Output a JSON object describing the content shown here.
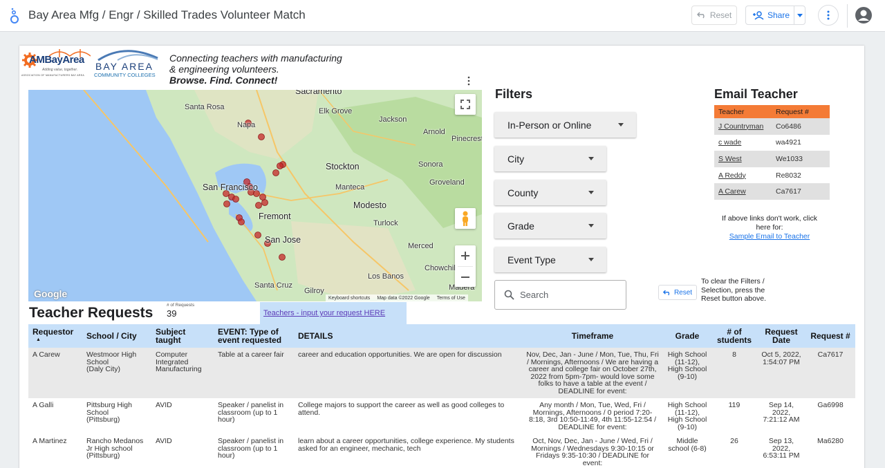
{
  "app": {
    "title": "Bay Area Mfg / Engr / Skilled Trades Volunteer Match",
    "reset_label": "Reset",
    "share_label": "Share"
  },
  "logos": {
    "ambay_word": "AMBayArea",
    "ambay_tagline": "Adding value, together.",
    "ambay_full": "ASSOCIATION OF MANUFACTURERS BAY AREA",
    "bayarea_word": "BAY AREA",
    "bayarea_sub": "COMMUNITY COLLEGES"
  },
  "tagline": {
    "line1": "Connecting teachers with manufacturing",
    "line2": "& engineering volunteers.",
    "line3": "Browse. Find. Connect!"
  },
  "map": {
    "labels": {
      "sacramento": "Sacramento",
      "santa_rosa": "Santa Rosa",
      "elk_grove": "Elk Grove",
      "jackson": "Jackson",
      "arnold": "Arnold",
      "napa": "Napa",
      "pinecrest": "Pinecrest",
      "stockton": "Stockton",
      "sonora": "Sonora",
      "san_francisco": "San Francisco",
      "manteca": "Manteca",
      "groveland": "Groveland",
      "modesto": "Modesto",
      "fremont": "Fremont",
      "turlock": "Turlock",
      "san_jose": "San Jose",
      "merced": "Merced",
      "chowchilla": "Chowchilla",
      "los_banos": "Los Banos",
      "santa_cruz": "Santa Cruz",
      "gilroy": "Gilroy",
      "madera": "Madera"
    },
    "google_logo": "Google",
    "footer": {
      "shortcuts": "Keyboard shortcuts",
      "data": "Map data ©2022 Google",
      "terms": "Terms of Use"
    },
    "marker_color": "#c62828"
  },
  "filters": {
    "title": "Filters",
    "items": [
      {
        "label": "In-Person or Online"
      },
      {
        "label": "City"
      },
      {
        "label": "County"
      },
      {
        "label": "Grade"
      },
      {
        "label": "Event Type"
      }
    ],
    "search_placeholder": "Search",
    "reset_label": "Reset",
    "clear_note": "To clear the Filters / Selection, press the Reset button above."
  },
  "email": {
    "title": "Email Teacher",
    "columns": [
      "Teacher",
      "Request #"
    ],
    "rows": [
      {
        "teacher": "J Countryman",
        "request": "Co6486"
      },
      {
        "teacher": "c wade",
        "request": "wa4921"
      },
      {
        "teacher": "S West",
        "request": "We1033"
      },
      {
        "teacher": "A Reddy",
        "request": "Re8032"
      },
      {
        "teacher": "A Carew",
        "request": "Ca7617"
      }
    ],
    "note": "If above links don't work, click here for:",
    "sample_link": "Sample Email to Teacher",
    "header_color": "#f47b36"
  },
  "requests": {
    "title": "Teacher Requests",
    "count_label": "# of Requests",
    "count": "39",
    "input_link": "Teachers - input your request HERE",
    "columns": {
      "requestor": "Requestor",
      "school": "School / City",
      "subject": "Subject taught",
      "event": "EVENT: Type of event requested",
      "details": "DETAILS",
      "timeframe": "Timeframe",
      "grade": "Grade",
      "students": "# of students",
      "date": "Request Date",
      "request": "Request #"
    },
    "sort_indicator": "▲",
    "rows": [
      {
        "requestor": "A Carew",
        "school": "Westmoor High School\n(Daly City)",
        "subject": "Computer Integrated Manufacturing",
        "event": "Table at a career fair",
        "details": "career and education opportunities. We are open for discussion",
        "timeframe": "Nov, Dec, Jan - June / Mon, Tue, Thu, Fri / Mornings, Afternoons / We are having a career and college fair on October 27th, 2022 from 5pm-7pm- would love some folks to have a table at the event / DEADLINE for event:",
        "grade": "High School (11-12), High School (9-10)",
        "students": "8",
        "date": "Oct 5, 2022, 1:54:07 PM",
        "request": "Ca7617"
      },
      {
        "requestor": "A Galli",
        "school": "Pittsburg High School\n(Pittsburg)",
        "subject": "AVID",
        "event": "Speaker / panelist in classroom (up to 1 hour)",
        "details": "College majors to support the career as well as good colleges to attend.",
        "timeframe": "Any month / Mon, Tue, Wed, Fri / Mornings, Afternoons / 0 period 7:20-8:18, 3rd 10:50-11:49, 4th 11:55-12:54 / DEADLINE for event:",
        "grade": "High School (11-12), High School (9-10)",
        "students": "119",
        "date": "Sep 14, 2022, 7:21:12 AM",
        "request": "Ga6998"
      },
      {
        "requestor": "A Martinez",
        "school": "Rancho Medanos Jr High school\n(Pittsburg)",
        "subject": "AVID",
        "event": "Speaker / panelist in classroom (up to 1 hour)",
        "details": "learn about a career opportunities, college experience. My students asked for an engineer, mechanic, tech",
        "timeframe": "Oct, Nov, Dec, Jan - June / Wed, Fri / Mornings / Wednesdays 9:30-10:15 or Fridays 9:35-10:30 / DEADLINE for event:",
        "grade": "Middle school (6-8)",
        "students": "26",
        "date": "Sep 13, 2022, 6:53:11 PM",
        "request": "Ma6280"
      }
    ]
  }
}
